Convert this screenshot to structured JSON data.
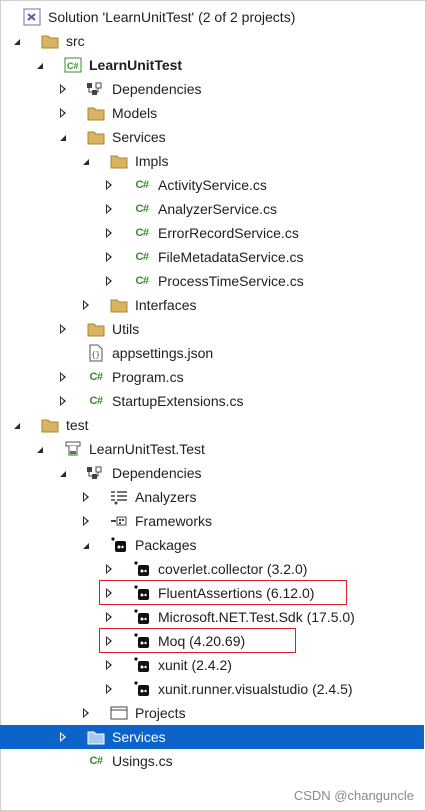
{
  "tree": {
    "solution": "Solution 'LearnUnitTest' (2 of 2 projects)",
    "src_folder": "src",
    "project_main": "LearnUnitTest",
    "dependencies": "Dependencies",
    "models": "Models",
    "services": "Services",
    "impls": "Impls",
    "activity_service": "ActivityService.cs",
    "analyzer_service": "AnalyzerService.cs",
    "error_record_service": "ErrorRecordService.cs",
    "file_metadata_service": "FileMetadataService.cs",
    "process_time_service": "ProcessTimeService.cs",
    "interfaces": "Interfaces",
    "utils": "Utils",
    "appsettings": "appsettings.json",
    "program": "Program.cs",
    "startup_extensions": "StartupExtensions.cs",
    "test_folder": "test",
    "project_test": "LearnUnitTest.Test",
    "test_dependencies": "Dependencies",
    "analyzers": "Analyzers",
    "frameworks": "Frameworks",
    "packages": "Packages",
    "pkg_coverlet": "coverlet.collector (3.2.0)",
    "pkg_fluent": "FluentAssertions (6.12.0)",
    "pkg_testsdk": "Microsoft.NET.Test.Sdk (17.5.0)",
    "pkg_moq": "Moq (4.20.69)",
    "pkg_xunit": "xunit (2.4.2)",
    "pkg_xunit_runner": "xunit.runner.visualstudio (2.4.5)",
    "projects": "Projects",
    "test_services": "Services",
    "usings": "Usings.cs"
  },
  "icons": {
    "cs_glyph": "C#"
  },
  "colors": {
    "selection": "#0c63c9",
    "folder": "#c8a24a",
    "highlight_box": "#d9202a",
    "csharp_green": "#3c8b2a"
  },
  "watermark": "CSDN @changuncle"
}
